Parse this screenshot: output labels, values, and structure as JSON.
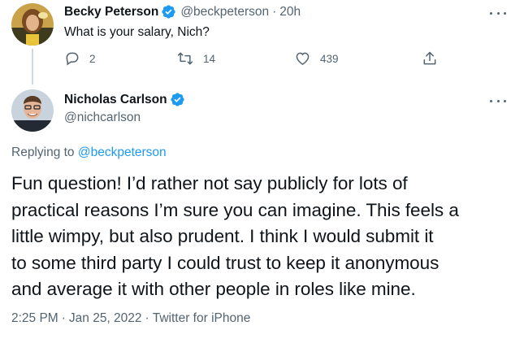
{
  "reply_to_tweet": {
    "author": {
      "display_name": "Becky Peterson",
      "handle": "@beckpeterson",
      "verified": true
    },
    "time_ago": "20h",
    "separator": "·",
    "text": "What is your salary, Nich?",
    "actions": {
      "replies": "2",
      "retweets": "14",
      "likes": "439"
    }
  },
  "main_tweet": {
    "author": {
      "display_name": "Nicholas Carlson",
      "handle": "@nichcarlson",
      "verified": true
    },
    "replying_prefix": "Replying to",
    "replying_to": "@beckpeterson",
    "text_lines": [
      "Fun question! I’d rather not say publicly for lots of",
      "practical reasons I’m sure you can imagine. This feels a",
      "little wimpy, but also prudent. I think I would submit it",
      "to some third party I could trust to keep it anonymous",
      "and average it with other people in roles like mine."
    ],
    "time": "2:25 PM",
    "date": "Jan 25, 2022",
    "client": "Twitter for iPhone",
    "separator": "·"
  },
  "icons": {
    "reply": "reply-icon",
    "retweet": "retweet-icon",
    "like": "heart-icon",
    "share": "share-icon",
    "verified": "verified-badge-icon",
    "more": "more-icon"
  },
  "colors": {
    "text_primary": "#0f1419",
    "text_secondary": "#536471",
    "link": "#1d9bf0",
    "verified": "#1d9bf0",
    "thread_line": "#cfd9de"
  }
}
